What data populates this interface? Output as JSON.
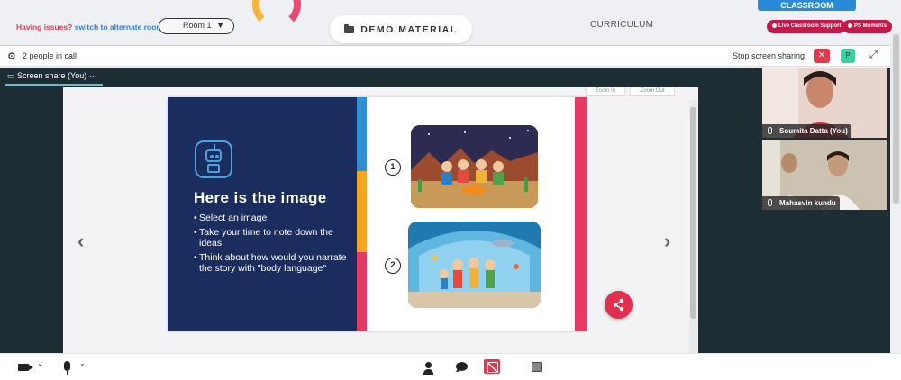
{
  "header": {
    "issue_text": "Having issues?",
    "alternate_link": "switch to alternate room",
    "room_value": "Room 1",
    "demo_label": "DEMO MATERIAL",
    "curriculum_label": "CURRICULUM",
    "classroom_label": "CLASSROOM",
    "support_label": "Live Classroom Support",
    "ps_label": "PS Moments"
  },
  "call": {
    "people_count": "2 people in call",
    "stop_share_label": "Stop screen sharing",
    "close_label": "✕",
    "p_label": "P",
    "share_tab_label": "Screen share (You)",
    "share_tab_menu": "···"
  },
  "viewer": {
    "zoom_in": "Zoom In",
    "zoom_out": "Zoom Out"
  },
  "slide": {
    "title": "Here is the image",
    "bullets": [
      "Select an image",
      "Take your time to note down the ideas",
      "Think about how would you narrate the story with \"body language\""
    ],
    "num1": "1",
    "num2": "2"
  },
  "participants": [
    {
      "name": "Soumita Datta (You)"
    },
    {
      "name": "Mahasvin kundu"
    }
  ],
  "colors": {
    "accent_red": "#e0304d",
    "slide_navy": "#1b2d5e",
    "brand_blue": "#2b8ad6"
  },
  "icons": [
    "gear-icon",
    "close-icon",
    "expand-icon",
    "chevron-left-icon",
    "chevron-right-icon",
    "share-icon",
    "camera-icon",
    "mic-icon",
    "people-icon",
    "chat-icon",
    "screen-share-icon",
    "whiteboard-icon",
    "folder-icon",
    "robot-icon"
  ]
}
